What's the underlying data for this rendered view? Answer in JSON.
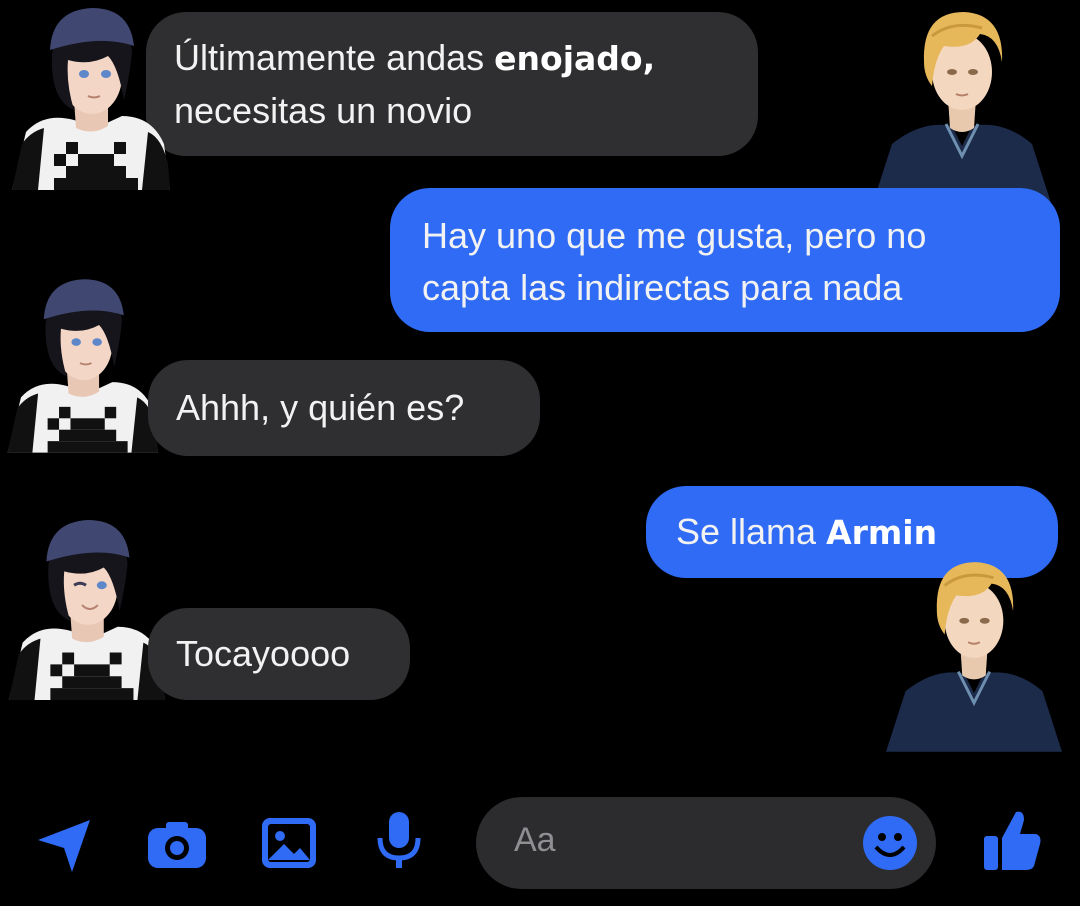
{
  "conversation": {
    "messages": [
      {
        "side": "received",
        "lines": [
          "Últimamente andas ",
          "necesitas un novio"
        ],
        "emphasis": "enojado,"
      },
      {
        "side": "sent",
        "lines": [
          "Hay uno que me gusta, pero no",
          "capta las indirectas para nada"
        ]
      },
      {
        "side": "received",
        "text": "Ahhh, y quién es?"
      },
      {
        "side": "sent",
        "prefix": "Se llama ",
        "emphasis": "Armin"
      },
      {
        "side": "received",
        "text": "Tocayoooo"
      }
    ]
  },
  "composer": {
    "placeholder": "Aa",
    "icons": [
      "send-location-icon",
      "camera-icon",
      "gallery-icon",
      "microphone-icon",
      "emoji-icon",
      "like-icon"
    ]
  },
  "colors": {
    "background": "#000000",
    "received_bubble": "#2f2f31",
    "sent_bubble": "#2f6bf5",
    "accent": "#2f6bf5",
    "input_bg": "#2c2c2e"
  }
}
